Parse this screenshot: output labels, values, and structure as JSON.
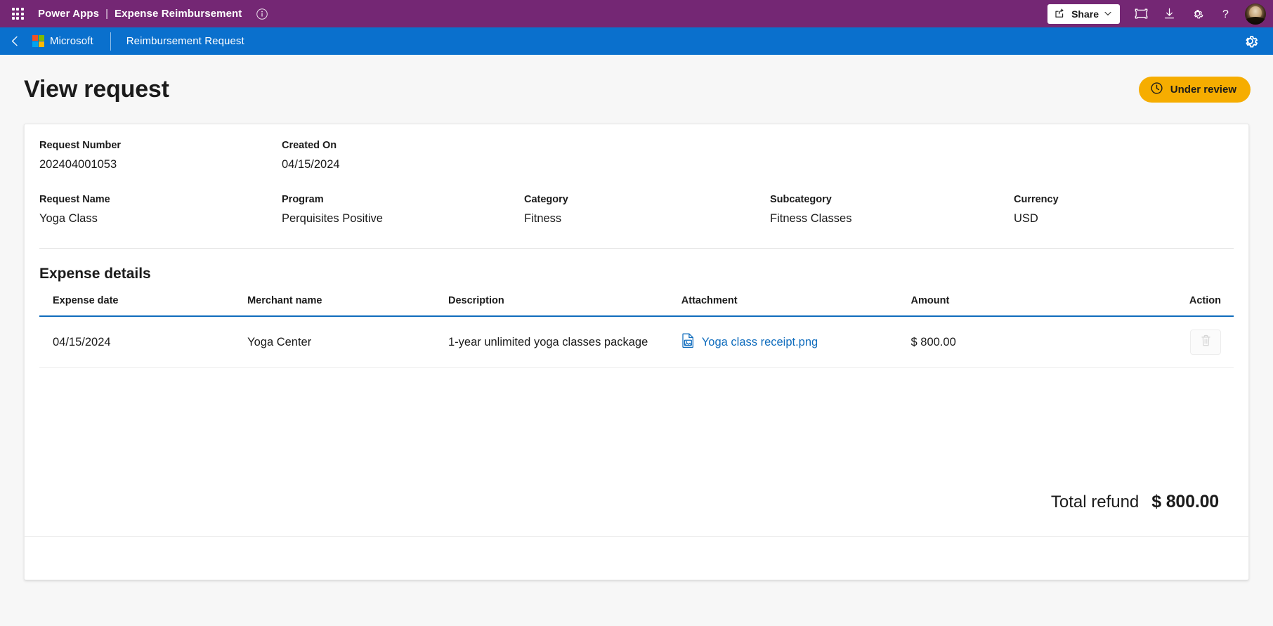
{
  "topbar": {
    "waffle_label": "app-launcher",
    "app_name": "Power Apps",
    "separator": "|",
    "document_name": "Expense Reimbursement",
    "info_icon": "info-circle-icon",
    "share_label": "Share",
    "share_chevron": "⌄",
    "icons": [
      "fullscreen-icon",
      "download-icon",
      "settings-gear-icon",
      "help-question-icon"
    ],
    "avatar": "user-avatar"
  },
  "appbar": {
    "back_icon": "chevron-left-icon",
    "org_name": "Microsoft",
    "title": "Reimbursement Request",
    "gear_icon": "settings-gear-icon",
    "background_color": "#0a70cd"
  },
  "page": {
    "title": "View request",
    "status": {
      "label": "Under review",
      "icon": "clock-icon",
      "color": "#f6ad00"
    }
  },
  "fields": {
    "row1": [
      {
        "label": "Request Number",
        "value": "202404001053"
      },
      {
        "label": "Created On",
        "value": "04/15/2024"
      }
    ],
    "row2": [
      {
        "label": "Request Name",
        "value": "Yoga Class"
      },
      {
        "label": "Program",
        "value": "Perquisites Positive"
      },
      {
        "label": "Category",
        "value": "Fitness"
      },
      {
        "label": "Subcategory",
        "value": "Fitness Classes"
      },
      {
        "label": "Currency",
        "value": "USD"
      }
    ]
  },
  "expense_details": {
    "section_title": "Expense details",
    "columns": [
      "Expense date",
      "Merchant name",
      "Description",
      "Attachment",
      "Amount",
      "Action"
    ],
    "rows": [
      {
        "expense_date": "04/15/2024",
        "merchant_name": "Yoga Center",
        "description": "1-year unlimited yoga classes package",
        "attachment_name": "Yoga class receipt.png",
        "attachment_icon": "image-file-icon",
        "amount": "$ 800.00",
        "action_icon": "trash-delete-icon"
      }
    ],
    "total_label": "Total refund",
    "total_amount": "$ 800.00"
  },
  "colors": {
    "brand_purple": "#742774",
    "brand_blue": "#0a70cd",
    "accent_link": "#0f6cbd",
    "status_amber": "#f6ad00"
  }
}
